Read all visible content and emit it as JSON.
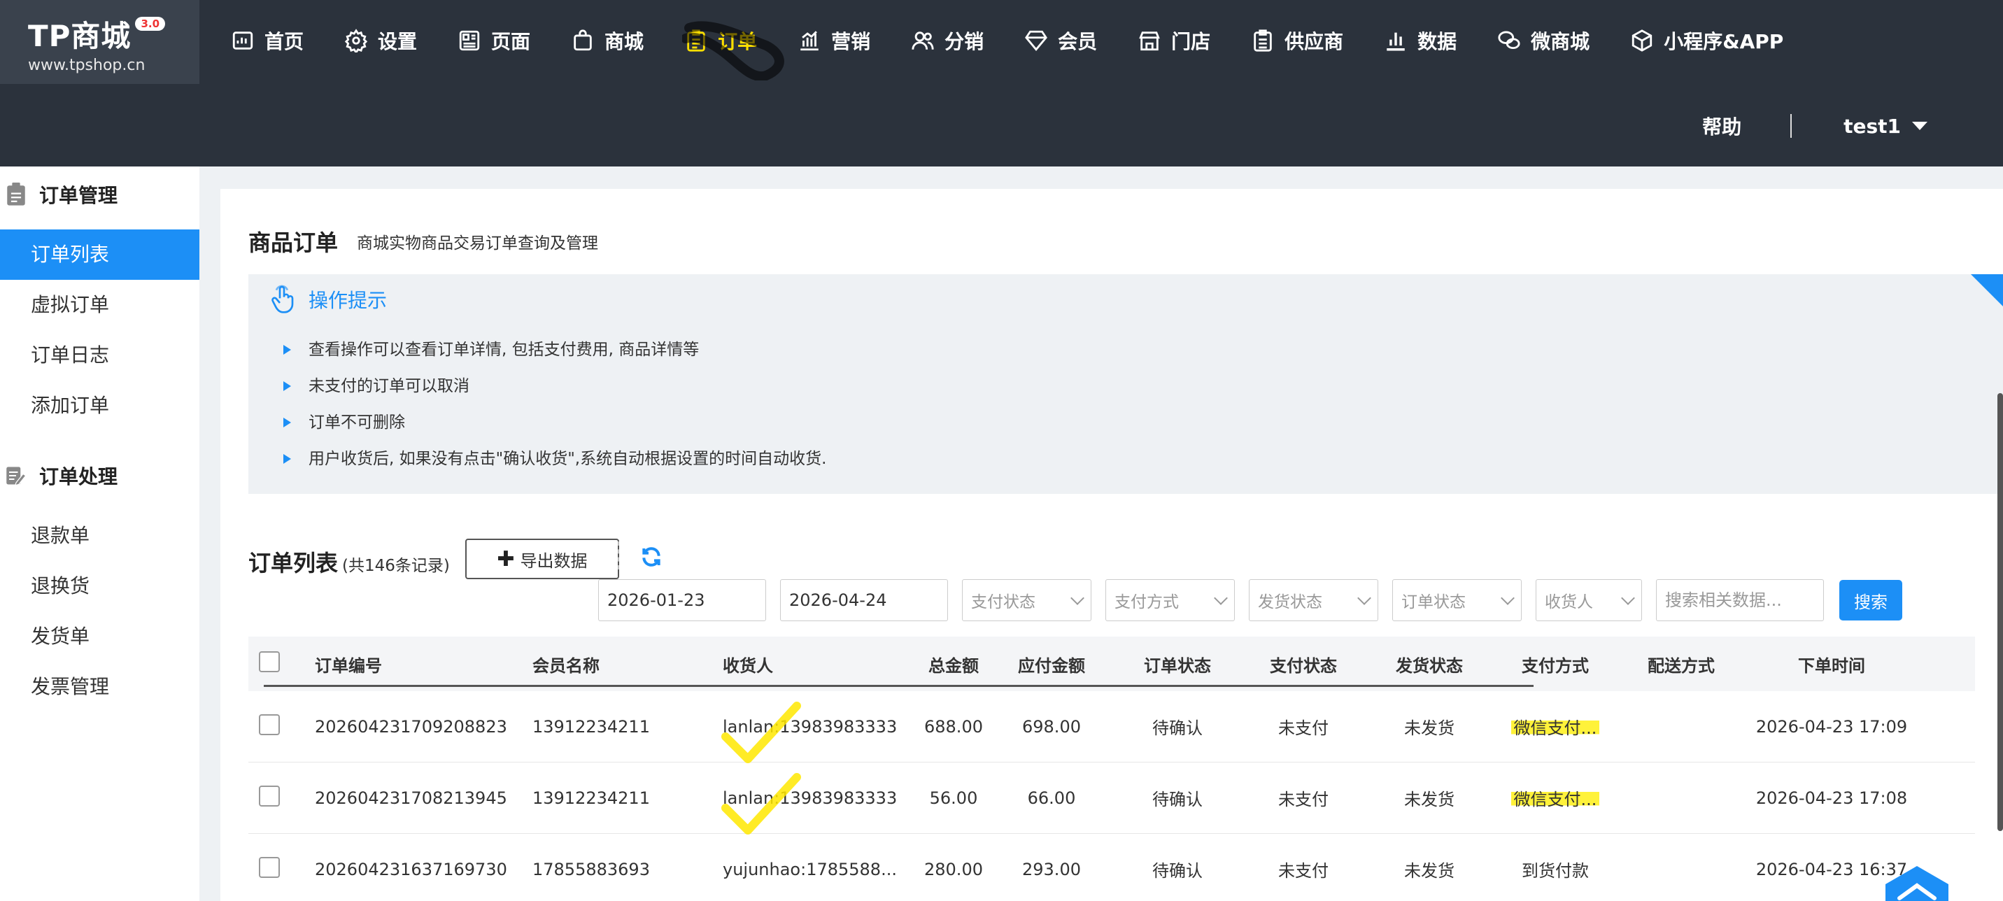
{
  "app": {
    "logo_title": "TP商城",
    "logo_version": "3.0",
    "logo_url": "www.tpshop.cn"
  },
  "nav": {
    "items": [
      {
        "label": "首页",
        "icon": "dashboard-icon"
      },
      {
        "label": "设置",
        "icon": "gear-icon"
      },
      {
        "label": "页面",
        "icon": "layout-icon"
      },
      {
        "label": "商城",
        "icon": "shopping-bag-icon"
      },
      {
        "label": "订单",
        "icon": "order-clipboard-icon",
        "active": true
      },
      {
        "label": "营销",
        "icon": "chart-bar-icon"
      },
      {
        "label": "分销",
        "icon": "users-icon"
      },
      {
        "label": "会员",
        "icon": "diamond-icon"
      },
      {
        "label": "门店",
        "icon": "store-icon"
      },
      {
        "label": "供应商",
        "icon": "supplier-list-icon"
      },
      {
        "label": "数据",
        "icon": "stats-icon"
      },
      {
        "label": "微商城",
        "icon": "wechat-icon"
      },
      {
        "label": "小程序&APP",
        "icon": "cube-icon"
      }
    ],
    "help": "帮助",
    "user": "test1"
  },
  "sidebar": {
    "groups": [
      {
        "title": "订单管理",
        "icon": "clipboard-icon",
        "items": [
          "订单列表",
          "虚拟订单",
          "订单日志",
          "添加订单"
        ]
      },
      {
        "title": "订单处理",
        "icon": "edit-note-icon",
        "items": [
          "退款单",
          "退换货",
          "发货单",
          "发票管理"
        ]
      }
    ],
    "active_item": "订单列表"
  },
  "page": {
    "title": "商品订单",
    "subtitle": "商城实物商品交易订单查询及管理"
  },
  "tips": {
    "title": "操作提示",
    "items": [
      "查看操作可以查看订单详情, 包括支付费用, 商品详情等",
      "未支付的订单可以取消",
      "订单不可删除",
      "用户收货后, 如果没有点击\"确认收货\",系统自动根据设置的时间自动收货."
    ]
  },
  "list": {
    "title": "订单列表",
    "count_text": "(共146条记录)",
    "export_label": "导出数据"
  },
  "filters": {
    "date_start": "2026-01-23",
    "date_end": "2026-04-24",
    "selects": [
      "支付状态",
      "支付方式",
      "发货状态",
      "订单状态",
      "收货人"
    ],
    "search_placeholder": "搜索相关数据...",
    "search_button": "搜索"
  },
  "table": {
    "headers": [
      "订单编号",
      "会员名称",
      "收货人",
      "总金额",
      "应付金额",
      "订单状态",
      "支付状态",
      "发货状态",
      "支付方式",
      "配送方式",
      "下单时间"
    ],
    "rows": [
      {
        "order_sn": "202604231709208823",
        "member": "13912234211",
        "receiver": "lanlan:13983983333",
        "total": "688.00",
        "payable": "698.00",
        "order_status": "待确认",
        "pay_status": "未支付",
        "ship_status": "未发货",
        "pay_method": "微信支付...",
        "delivery": "",
        "time": "2026-04-23 17:09"
      },
      {
        "order_sn": "202604231708213945",
        "member": "13912234211",
        "receiver": "lanlan:13983983333",
        "total": "56.00",
        "payable": "66.00",
        "order_status": "待确认",
        "pay_status": "未支付",
        "ship_status": "未发货",
        "pay_method": "微信支付...",
        "delivery": "",
        "time": "2026-04-23 17:08"
      },
      {
        "order_sn": "202604231637169730",
        "member": "17855883693",
        "receiver": "yujunhao:1785588...",
        "total": "280.00",
        "payable": "293.00",
        "order_status": "待确认",
        "pay_status": "未支付",
        "ship_status": "未发货",
        "pay_method": "到货付款",
        "delivery": "",
        "time": "2026-04-23 16:37"
      }
    ]
  },
  "colors": {
    "topbar": "#2b323c",
    "accent": "#1c8ff6",
    "active_nav": "#ffe000",
    "highlight": "#fff23a"
  }
}
